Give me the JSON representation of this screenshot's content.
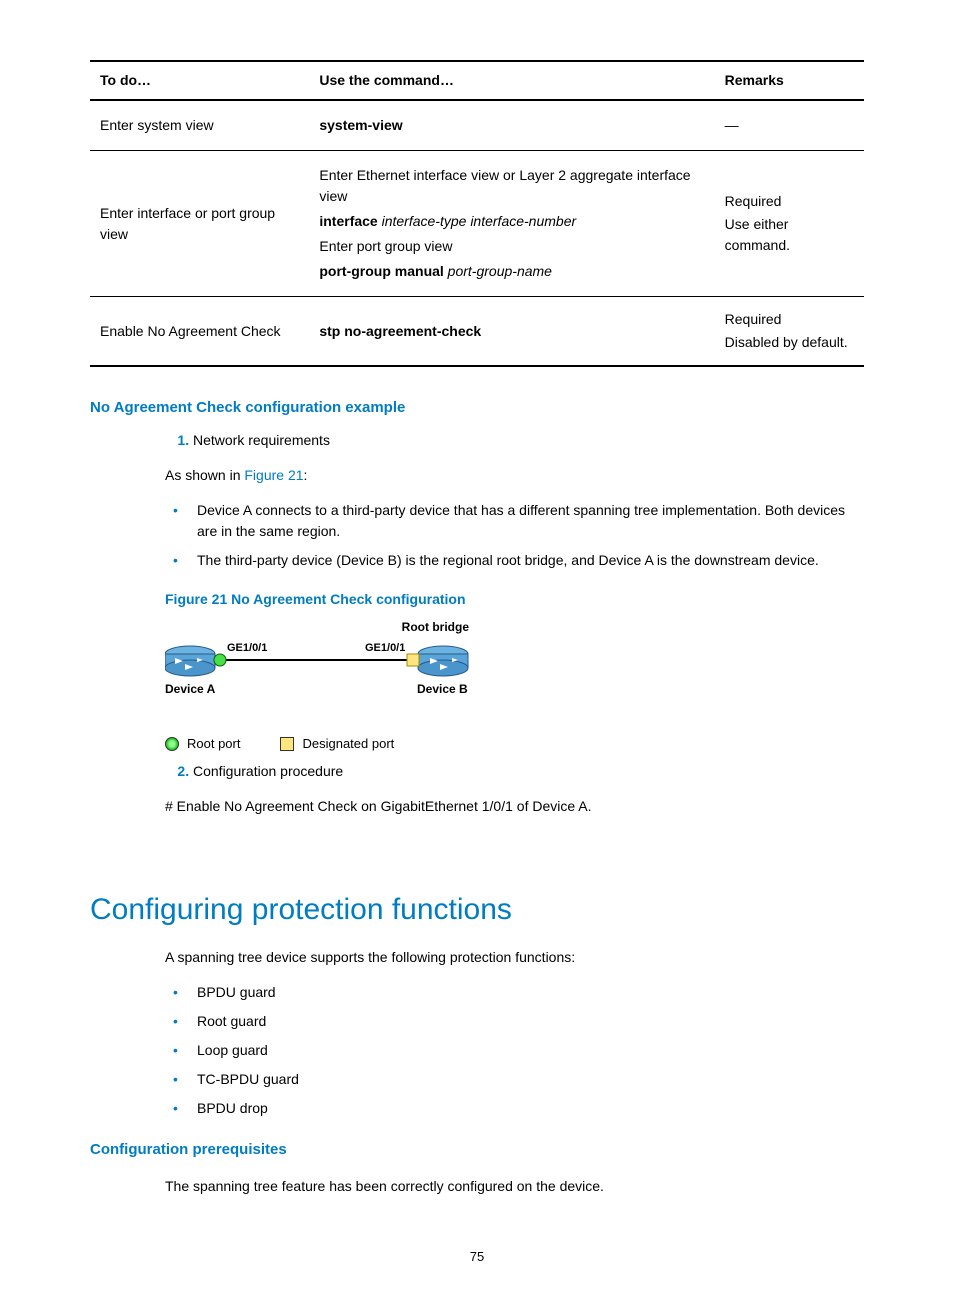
{
  "table": {
    "headers": [
      "To do…",
      "Use the command…",
      "Remarks"
    ],
    "rows": [
      {
        "todo": "Enter system view",
        "cmd_lines": [
          {
            "bold": "system-view",
            "italic": ""
          }
        ],
        "remarks": [
          "—"
        ]
      },
      {
        "todo": "Enter interface or port group view",
        "cmd_lines": [
          {
            "plain": "Enter Ethernet interface view or Layer 2 aggregate interface view"
          },
          {
            "bold": "interface",
            "italic": " interface-type interface-number"
          },
          {
            "plain": "Enter port group view"
          },
          {
            "bold": "port-group manual",
            "italic": " port-group-name"
          }
        ],
        "remarks": [
          "Required",
          "Use either command."
        ]
      },
      {
        "todo": "Enable No Agreement Check",
        "cmd_lines": [
          {
            "bold": "stp no-agreement-check"
          }
        ],
        "remarks": [
          "Required",
          "Disabled by default."
        ]
      }
    ]
  },
  "section1": {
    "title": "No Agreement Check configuration example",
    "step1": "Network requirements",
    "intro_prefix": "As shown in ",
    "intro_link": "Figure 21",
    "intro_suffix": ":",
    "bullets": [
      "Device A connects to a third-party device that has a different spanning tree implementation. Both devices are in the same region.",
      "The third-party device (Device B) is the regional root bridge, and Device A is the downstream device."
    ],
    "figure_caption": "Figure 21 No Agreement Check configuration",
    "figure": {
      "root_bridge": "Root bridge",
      "ge_a": "GE1/0/1",
      "ge_b": "GE1/0/1",
      "device_a": "Device A",
      "device_b": "Device B",
      "legend_root": "Root port",
      "legend_desig": "Designated port"
    },
    "step2": "Configuration procedure",
    "proc_text": "# Enable No Agreement Check on GigabitEthernet 1/0/1 of Device A."
  },
  "section2": {
    "title": "Configuring protection functions",
    "intro": "A spanning tree device supports the following protection functions:",
    "bullets": [
      "BPDU guard",
      "Root guard",
      "Loop guard",
      "TC-BPDU guard",
      "BPDU drop"
    ],
    "sub_title": "Configuration prerequisites",
    "sub_text": "The spanning tree feature has been correctly configured on the device."
  },
  "page_number": "75"
}
